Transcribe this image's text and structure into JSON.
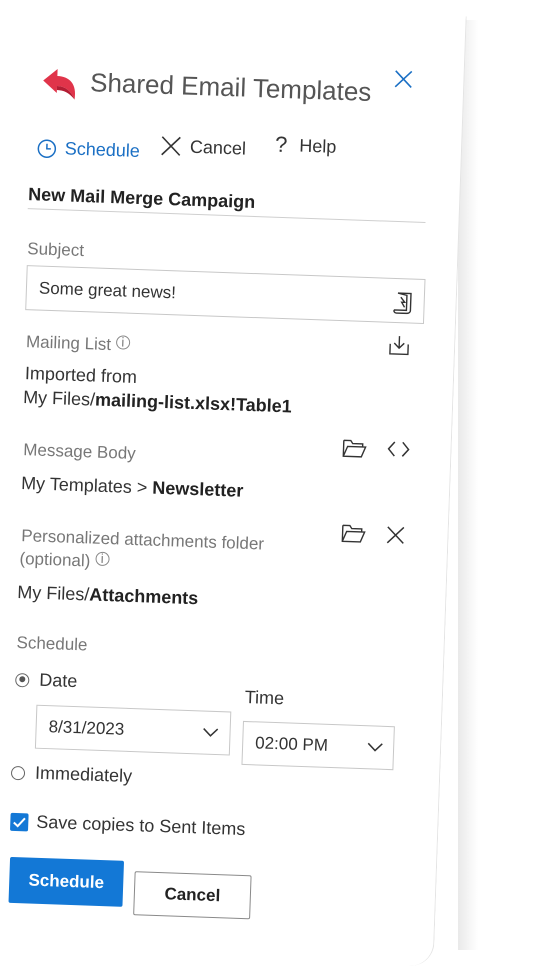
{
  "header": {
    "title": "Shared Email Templates",
    "close_icon": "close-icon",
    "logo_icon": "reply-arrow-logo"
  },
  "toolbar": {
    "schedule_label": "Schedule",
    "cancel_label": "Cancel",
    "help_label": "Help"
  },
  "campaign_name": "New Mail Merge Campaign",
  "subject": {
    "label": "Subject",
    "value": "Some great news!"
  },
  "mailing_list": {
    "label": "Mailing List",
    "line1": "Imported from",
    "path_prefix": "My Files/",
    "path_file": "mailing-list.xlsx!Table1"
  },
  "message_body": {
    "label": "Message Body",
    "path_prefix": "My Templates > ",
    "template_name": "Newsletter"
  },
  "attachments": {
    "label_line1": "Personalized attachments folder",
    "label_line2": "(optional)",
    "path_prefix": "My Files/",
    "folder": "Attachments"
  },
  "schedule": {
    "label": "Schedule",
    "date_option": "Date",
    "date_value": "8/31/2023",
    "time_label": "Time",
    "time_value": "02:00 PM",
    "immediately_option": "Immediately",
    "selected": "date"
  },
  "save_copies": {
    "label": "Save copies to Sent Items",
    "checked": true
  },
  "footer": {
    "schedule_button": "Schedule",
    "cancel_button": "Cancel"
  },
  "colors": {
    "accent": "#1378d6",
    "logo": "#e0344a"
  }
}
